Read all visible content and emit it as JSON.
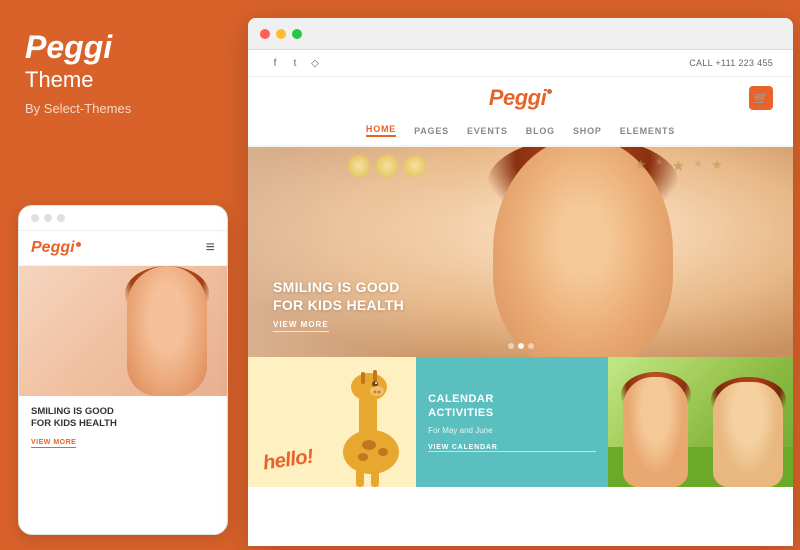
{
  "left": {
    "title": "Peggi",
    "subtitle": "Theme",
    "byline": "By Select-Themes"
  },
  "mobile": {
    "dots": [
      "dot1",
      "dot2",
      "dot3"
    ],
    "logo": "Peggi",
    "hamburger": "≡",
    "hero_caption": "SMILING IS GOOD\nFOR KIDS HEALTH",
    "view_more": "VIEW MORE"
  },
  "browser": {
    "dots": [
      "red",
      "yellow",
      "green"
    ]
  },
  "site": {
    "social": [
      "f",
      "t",
      "♦"
    ],
    "phone": "CALL  +111 223 455",
    "logo": "Peggi",
    "nav": [
      {
        "label": "HOME",
        "active": true
      },
      {
        "label": "PAGES",
        "active": false
      },
      {
        "label": "EVENTS",
        "active": false
      },
      {
        "label": "BLOG",
        "active": false
      },
      {
        "label": "SHOP",
        "active": false
      },
      {
        "label": "ELEMENTS",
        "active": false
      }
    ],
    "hero": {
      "caption_line1": "SMILING IS GOOD",
      "caption_line2": "FOR KIDS HEALTH",
      "view_more": "VIEW MORE"
    },
    "grid": {
      "cell1": {
        "hello": "hello!"
      },
      "cell2": {
        "title_line1": "CALENDAR",
        "title_line2": "ACtIVITIES",
        "subtitle": "For May and June",
        "link": "VIEW CALENDAR"
      },
      "cell3": {}
    }
  }
}
